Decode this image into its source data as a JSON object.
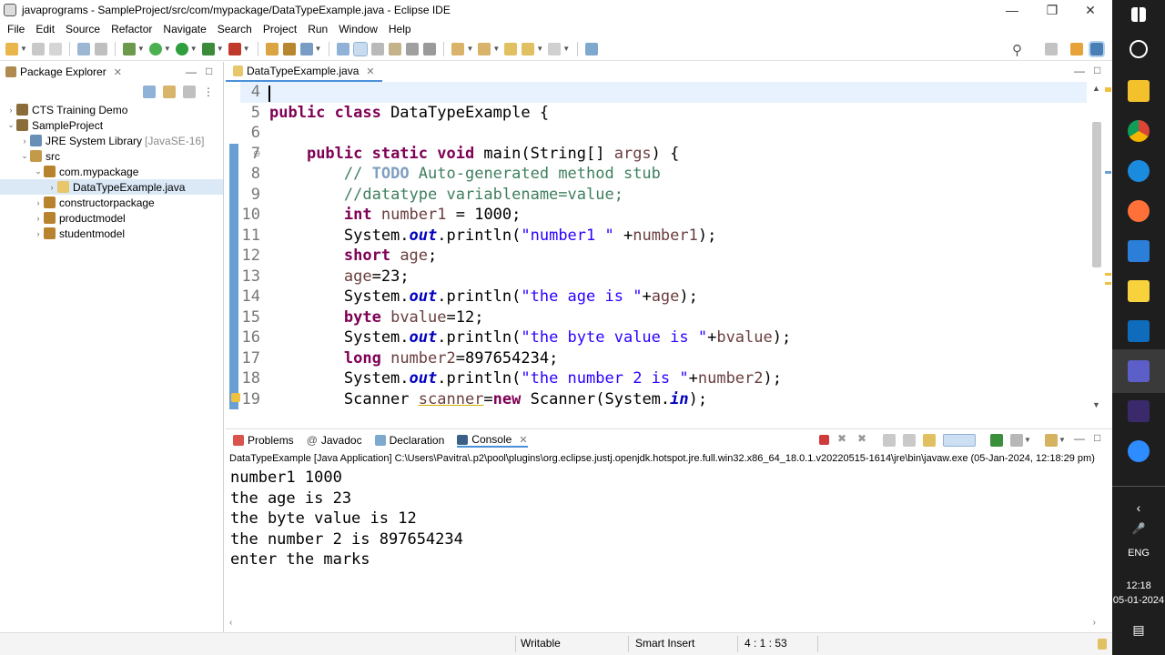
{
  "window": {
    "title": "javaprograms - SampleProject/src/com/mypackage/DataTypeExample.java - Eclipse IDE"
  },
  "menu": [
    "File",
    "Edit",
    "Source",
    "Refactor",
    "Navigate",
    "Search",
    "Project",
    "Run",
    "Window",
    "Help"
  ],
  "package_explorer": {
    "tab_label": "Package Explorer",
    "tree": [
      {
        "label": "CTS Training Demo",
        "level": 0,
        "arrow": "›",
        "icon": "project-icon"
      },
      {
        "label": "SampleProject",
        "level": 0,
        "arrow": "⌄",
        "icon": "project-icon"
      },
      {
        "label": "JRE System Library",
        "suffix": "[JavaSE-16]",
        "level": 1,
        "arrow": "›",
        "icon": "library-icon"
      },
      {
        "label": "src",
        "level": 1,
        "arrow": "⌄",
        "icon": "source-folder-icon"
      },
      {
        "label": "com.mypackage",
        "level": 2,
        "arrow": "⌄",
        "icon": "package-icon"
      },
      {
        "label": "DataTypeExample.java",
        "level": 3,
        "arrow": "›",
        "icon": "java-file-icon",
        "selected": true
      },
      {
        "label": "constructorpackage",
        "level": 2,
        "arrow": "›",
        "icon": "package-icon"
      },
      {
        "label": "productmodel",
        "level": 2,
        "arrow": "›",
        "icon": "package-icon"
      },
      {
        "label": "studentmodel",
        "level": 2,
        "arrow": "›",
        "icon": "package-icon"
      }
    ]
  },
  "editor": {
    "tab_label": "DataTypeExample.java",
    "lines": [
      {
        "n": "4",
        "segs": []
      },
      {
        "n": "5",
        "segs": [
          [
            "kw",
            "public class "
          ],
          [
            "",
            "DataTypeExample {"
          ]
        ]
      },
      {
        "n": "6",
        "segs": []
      },
      {
        "n": "7",
        "segs": [
          [
            "",
            "    "
          ],
          [
            "kw",
            "public static void "
          ],
          [
            "",
            "main(String[] "
          ],
          [
            "var",
            "args"
          ],
          [
            "",
            ") {"
          ]
        ]
      },
      {
        "n": "8",
        "segs": [
          [
            "",
            "        "
          ],
          [
            "cm",
            "// "
          ],
          [
            "todo",
            "TODO"
          ],
          [
            "cm",
            " Auto-generated method stub"
          ]
        ]
      },
      {
        "n": "9",
        "segs": [
          [
            "",
            "        "
          ],
          [
            "cm",
            "//datatype variablename=value;"
          ]
        ]
      },
      {
        "n": "10",
        "segs": [
          [
            "",
            "        "
          ],
          [
            "kw",
            "int "
          ],
          [
            "var",
            "number1"
          ],
          [
            "",
            " = 1000;"
          ]
        ]
      },
      {
        "n": "11",
        "segs": [
          [
            "",
            "        System."
          ],
          [
            "fld",
            "out"
          ],
          [
            "",
            ".println("
          ],
          [
            "str",
            "\"number1 \""
          ],
          [
            "",
            " +"
          ],
          [
            "var",
            "number1"
          ],
          [
            "",
            ");"
          ]
        ]
      },
      {
        "n": "12",
        "segs": [
          [
            "",
            "        "
          ],
          [
            "kw",
            "short "
          ],
          [
            "var",
            "age"
          ],
          [
            "",
            ";"
          ]
        ]
      },
      {
        "n": "13",
        "segs": [
          [
            "",
            "        "
          ],
          [
            "var",
            "age"
          ],
          [
            "",
            "=23;"
          ]
        ]
      },
      {
        "n": "14",
        "segs": [
          [
            "",
            "        System."
          ],
          [
            "fld",
            "out"
          ],
          [
            "",
            ".println("
          ],
          [
            "str",
            "\"the age is \""
          ],
          [
            "",
            "+"
          ],
          [
            "var",
            "age"
          ],
          [
            "",
            ");"
          ]
        ]
      },
      {
        "n": "15",
        "segs": [
          [
            "",
            "        "
          ],
          [
            "kw",
            "byte "
          ],
          [
            "var",
            "bvalue"
          ],
          [
            "",
            "=12;"
          ]
        ]
      },
      {
        "n": "16",
        "segs": [
          [
            "",
            "        System."
          ],
          [
            "fld",
            "out"
          ],
          [
            "",
            ".println("
          ],
          [
            "str",
            "\"the byte value is \""
          ],
          [
            "",
            "+"
          ],
          [
            "var",
            "bvalue"
          ],
          [
            "",
            ");"
          ]
        ]
      },
      {
        "n": "17",
        "segs": [
          [
            "",
            "        "
          ],
          [
            "kw",
            "long "
          ],
          [
            "var",
            "number2"
          ],
          [
            "",
            "=897654234;"
          ]
        ]
      },
      {
        "n": "18",
        "segs": [
          [
            "",
            "        System."
          ],
          [
            "fld",
            "out"
          ],
          [
            "",
            ".println("
          ],
          [
            "str",
            "\"the number 2 is \""
          ],
          [
            "",
            "+"
          ],
          [
            "var",
            "number2"
          ],
          [
            "",
            ");"
          ]
        ]
      },
      {
        "n": "19",
        "segs": [
          [
            "",
            "        Scanner "
          ],
          [
            "var ul",
            "scanner"
          ],
          [
            "",
            "="
          ],
          [
            "kw",
            "new "
          ],
          [
            "",
            "Scanner(System."
          ],
          [
            "fld",
            "in"
          ],
          [
            "",
            ");"
          ]
        ]
      }
    ]
  },
  "bottom_panel": {
    "tabs": [
      "Problems",
      "Javadoc",
      "Declaration",
      "Console"
    ],
    "console_header": "DataTypeExample [Java Application] C:\\Users\\Pavitra\\.p2\\pool\\plugins\\org.eclipse.justj.openjdk.hotspot.jre.full.win32.x86_64_18.0.1.v20220515-1614\\jre\\bin\\javaw.exe  (05-Jan-2024, 12:18:29 pm)",
    "output": [
      "number1 1000",
      "the age is 23",
      "the byte value is 12",
      "the number 2 is 897654234",
      "enter the marks"
    ]
  },
  "status": {
    "writable": "Writable",
    "insert_mode": "Smart Insert",
    "position": "4 : 1 : 53"
  },
  "taskbar": {
    "lang": "ENG",
    "time": "12:18",
    "date": "05-01-2024"
  }
}
